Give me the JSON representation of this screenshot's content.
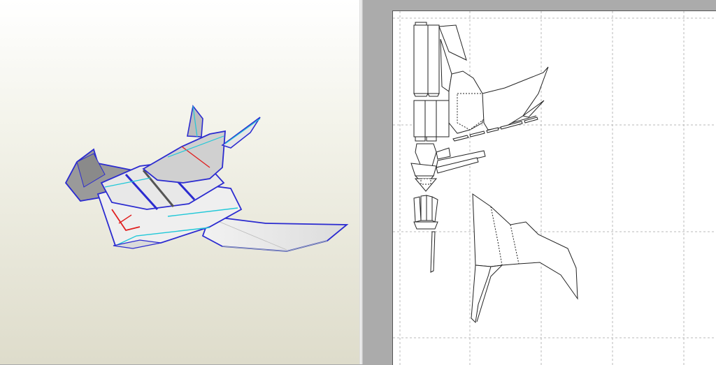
{
  "window": {
    "layout": "split-view"
  },
  "model_view": {
    "model": "spaceship",
    "edge_colors": {
      "fold": "#2a2ad0",
      "cut": "#20c8d8",
      "mountain": "#e02020"
    }
  },
  "unfold_view": {
    "grid_columns": 5,
    "grid_rows": 4,
    "line_color": "#222222",
    "grid_color": "#b8b8b8"
  }
}
